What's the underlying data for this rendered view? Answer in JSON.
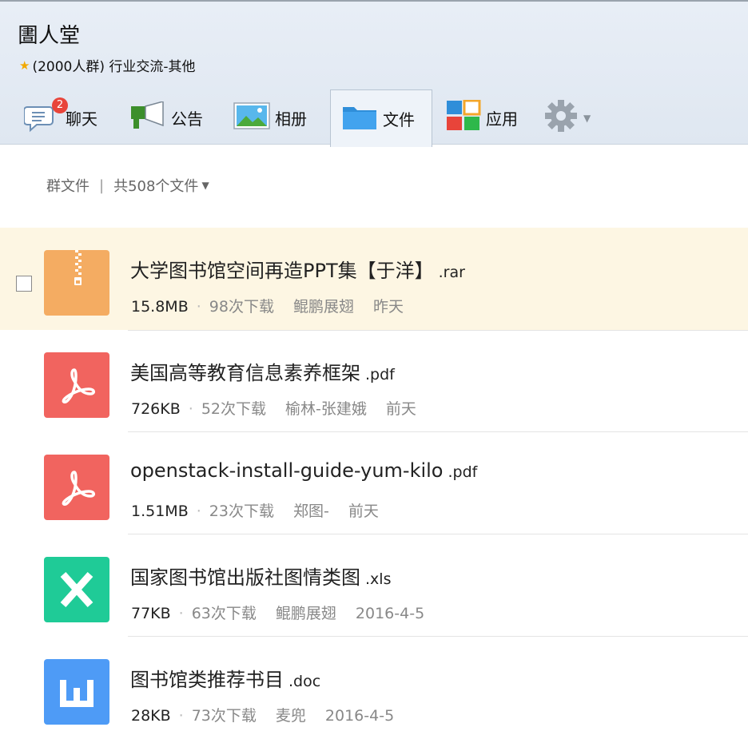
{
  "group": {
    "name": "圕人堂",
    "subtitle": "(2000人群) 行业交流-其他"
  },
  "tabs": [
    {
      "label": "聊天",
      "icon": "chat-bubble-icon",
      "badge": "2"
    },
    {
      "label": "公告",
      "icon": "megaphone-icon"
    },
    {
      "label": "相册",
      "icon": "picture-icon"
    },
    {
      "label": "文件",
      "icon": "folder-icon",
      "active": true
    },
    {
      "label": "应用",
      "icon": "apps-grid-icon"
    },
    {
      "label": "",
      "icon": "gear-icon"
    }
  ],
  "crumb": {
    "root": "群文件",
    "separator": "|",
    "count": "共508个文件"
  },
  "files": [
    {
      "name": "大学图书馆空间再造PPT集【于洋】",
      "ext": ".rar",
      "size": "15.8MB",
      "downloads": "98次下载",
      "uploader": "鲲鹏展翅",
      "date": "昨天",
      "type": "archive",
      "color": "#f4ac62"
    },
    {
      "name": "美国高等教育信息素养框架",
      "ext": ".pdf",
      "size": "726KB",
      "downloads": "52次下载",
      "uploader": "榆林-张建娥",
      "date": "前天",
      "type": "pdf",
      "color": "#f1645f"
    },
    {
      "name": "openstack-install-guide-yum-kilo",
      "ext": ".pdf",
      "size": "1.51MB",
      "downloads": "23次下载",
      "uploader": "郑图-",
      "date": "前天",
      "type": "pdf",
      "color": "#f1645f"
    },
    {
      "name": "国家图书馆出版社图情类图",
      "ext": ".xls",
      "size": "77KB",
      "downloads": "63次下载",
      "uploader": "鲲鹏展翅",
      "date": "2016-4-5",
      "type": "excel",
      "color": "#1fcb97"
    },
    {
      "name": "图书馆类推荐书目",
      "ext": ".doc",
      "size": "28KB",
      "downloads": "73次下载",
      "uploader": "麦兜",
      "date": "2016-4-5",
      "type": "word",
      "color": "#4e9bf6"
    }
  ]
}
